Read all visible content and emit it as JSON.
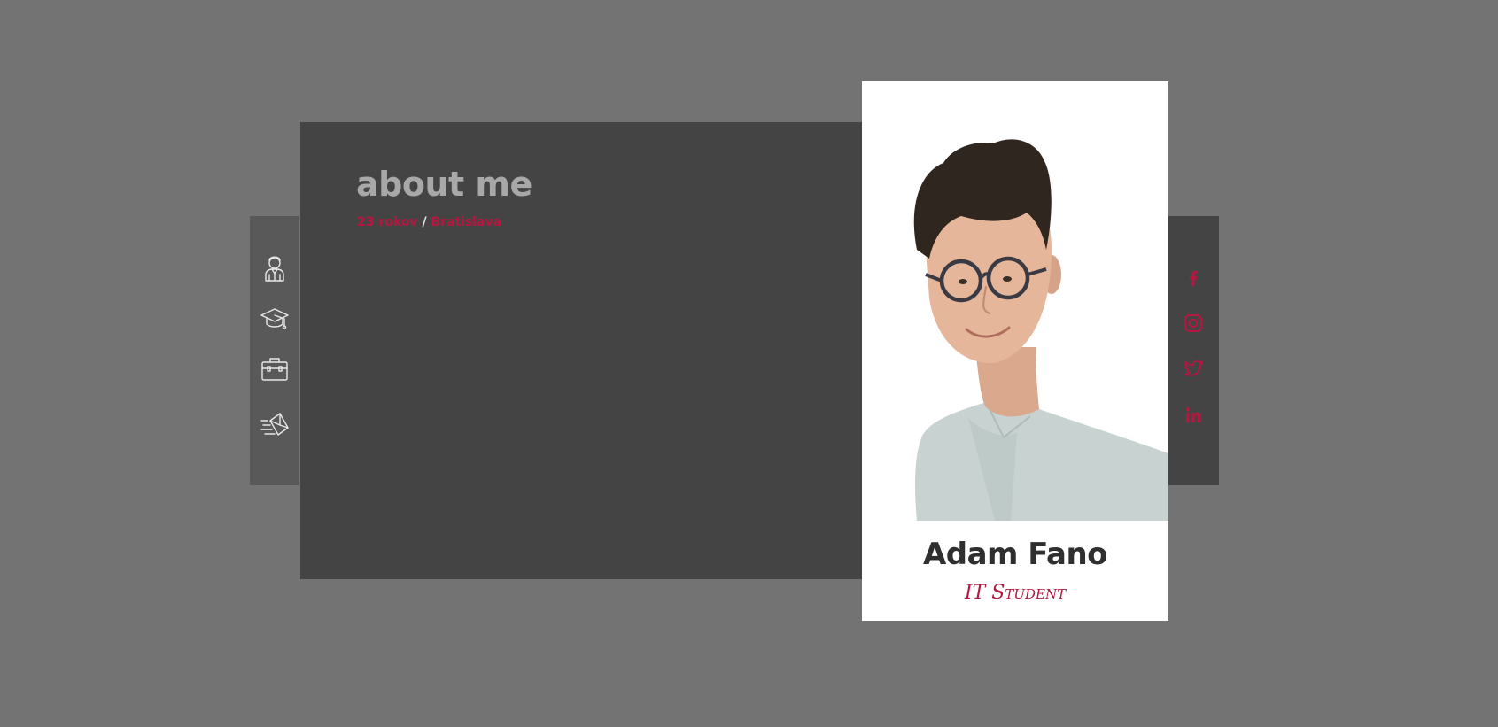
{
  "nav": {
    "items": [
      {
        "icon": "user-icon",
        "label": "About"
      },
      {
        "icon": "graduation-cap-icon",
        "label": "Education"
      },
      {
        "icon": "briefcase-icon",
        "label": "Experience"
      },
      {
        "icon": "send-mail-icon",
        "label": "Contact"
      }
    ]
  },
  "main": {
    "title": "about me",
    "age": "23 rokov",
    "separator": "/",
    "city": "Bratislava"
  },
  "profile": {
    "name": "Adam Fano",
    "role": "IT Student"
  },
  "social": {
    "items": [
      {
        "icon": "facebook-icon",
        "label": "Facebook"
      },
      {
        "icon": "instagram-icon",
        "label": "Instagram"
      },
      {
        "icon": "twitter-icon",
        "label": "Twitter"
      },
      {
        "icon": "linkedin-icon",
        "label": "LinkedIn"
      }
    ]
  },
  "colors": {
    "background": "#737373",
    "panel": "#444444",
    "nav": "#595959",
    "accent": "#b5173f",
    "title": "#a8a8a8",
    "card": "#ffffff"
  }
}
